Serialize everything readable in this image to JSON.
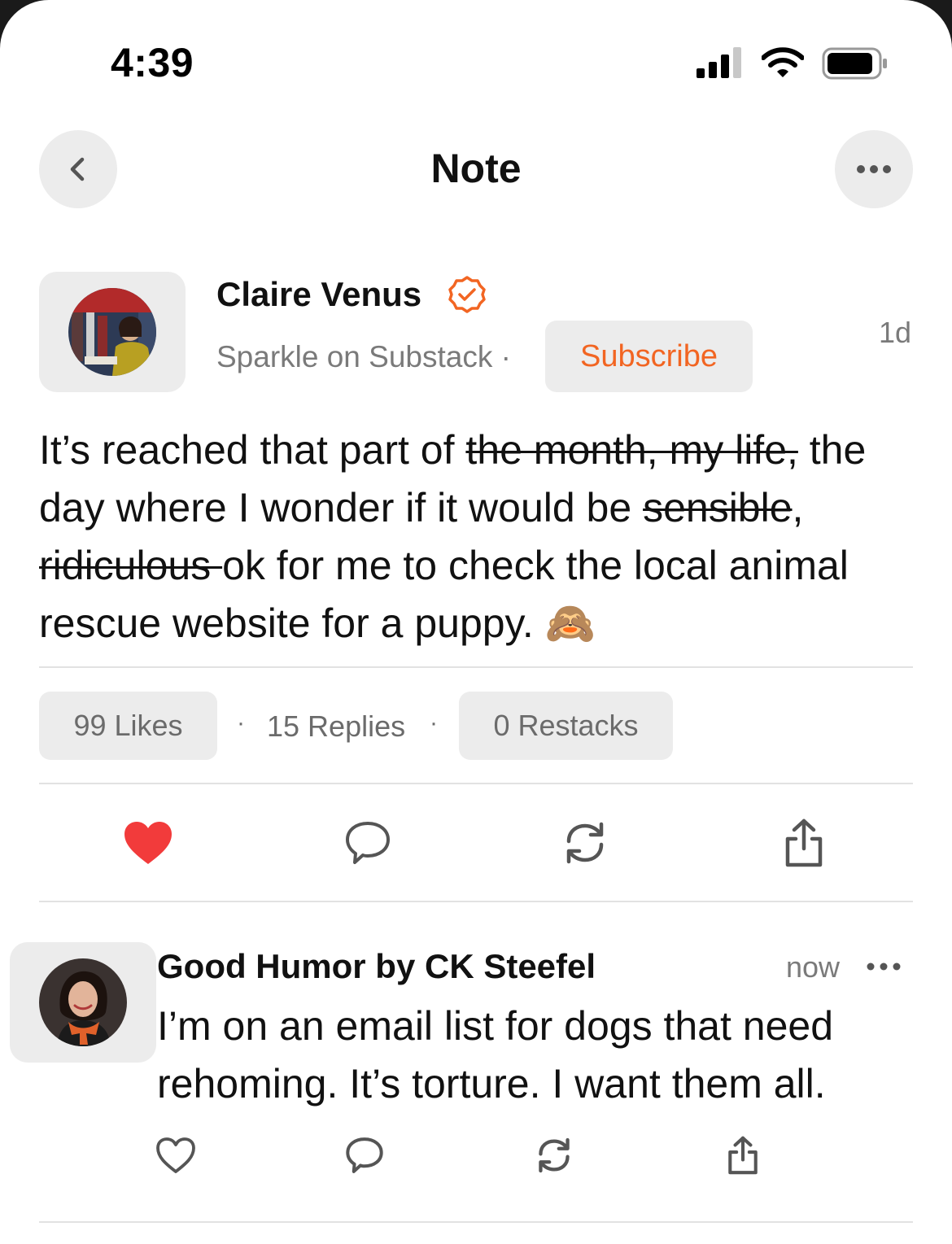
{
  "status": {
    "time": "4:39"
  },
  "nav": {
    "title": "Note"
  },
  "note": {
    "author": "Claire Venus",
    "publication": "Sparkle on Substack ·",
    "subscribe_label": "Subscribe",
    "time": "1d",
    "body": {
      "part1": "It’s reached that part of ",
      "strike1": "the month, my life,",
      "part2": " the day where I wonder if it would be ",
      "strike2": "sensible",
      "part3": ", ",
      "strike3": "ridiculous ",
      "part4": " ok for me to check the local animal rescue website for a puppy. ",
      "emoji": "🙈"
    },
    "stats": {
      "likes": "99 Likes",
      "replies": "15 Replies",
      "restacks": "0 Restacks",
      "separator": "·"
    },
    "liked": true
  },
  "reply": {
    "author": "Good Humor by CK Steefel",
    "time": "now",
    "text": "I’m on an email list for dogs that need rehoming. It’s torture. I want them all."
  },
  "colors": {
    "accent": "#f26522",
    "heart": "#f23b3b",
    "muted": "#7a7a7a",
    "pill_bg": "#ececec"
  },
  "icons": [
    "chevron-left-icon",
    "ellipsis-icon",
    "verified-badge-icon",
    "heart-icon",
    "comment-icon",
    "restack-icon",
    "share-icon",
    "signal-icon",
    "wifi-icon",
    "battery-icon"
  ]
}
